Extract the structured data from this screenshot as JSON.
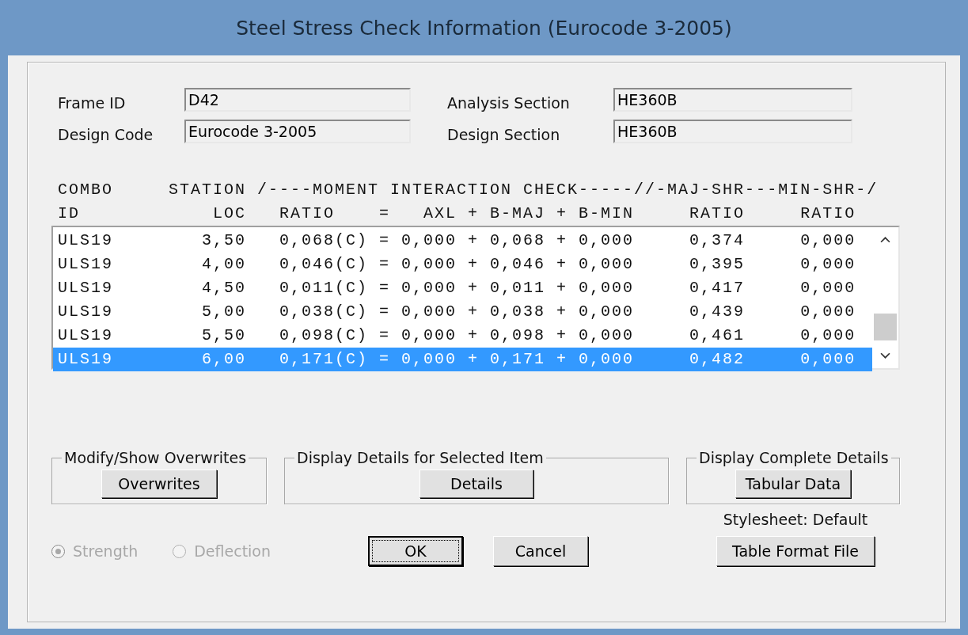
{
  "window": {
    "title": "Steel Stress Check Information (Eurocode 3-2005)"
  },
  "fields_left": [
    {
      "label": "Frame ID",
      "value": "D42"
    },
    {
      "label": "Design Code",
      "value": "Eurocode 3-2005"
    }
  ],
  "fields_right": [
    {
      "label": "Analysis Section",
      "value": "HE360B"
    },
    {
      "label": "Design Section",
      "value": "HE360B"
    }
  ],
  "table": {
    "header_lines": [
      "COMBO     STATION /----MOMENT INTERACTION CHECK-----//-MAJ-SHR---MIN-SHR-/",
      "ID            LOC   RATIO    =   AXL + B-MAJ + B-MIN     RATIO     RATIO"
    ],
    "rows": [
      {
        "text": "ULS19        3,50   0,068(C) = 0,000 + 0,068 + 0,000     0,374     0,000",
        "selected": false
      },
      {
        "text": "ULS19        4,00   0,046(C) = 0,000 + 0,046 + 0,000     0,395     0,000",
        "selected": false
      },
      {
        "text": "ULS19        4,50   0,011(C) = 0,000 + 0,011 + 0,000     0,417     0,000",
        "selected": false
      },
      {
        "text": "ULS19        5,00   0,038(C) = 0,000 + 0,038 + 0,000     0,439     0,000",
        "selected": false
      },
      {
        "text": "ULS19        5,50   0,098(C) = 0,000 + 0,098 + 0,000     0,461     0,000",
        "selected": false
      },
      {
        "text": "ULS19        6,00   0,171(C) = 0,000 + 0,171 + 0,000     0,482     0,000",
        "selected": true
      }
    ]
  },
  "groups": [
    {
      "title": "Modify/Show Overwrites",
      "button": "Overwrites"
    },
    {
      "title": "Display Details for Selected Item",
      "button": "Details"
    },
    {
      "title": "Display Complete Details",
      "button": "Tabular Data"
    }
  ],
  "stylesheet": "Stylesheet: Default",
  "radios": [
    {
      "label": "Strength",
      "selected": true,
      "disabled": true
    },
    {
      "label": "Deflection",
      "selected": false,
      "disabled": true
    }
  ],
  "buttons": [
    {
      "label": "OK",
      "focused": true
    },
    {
      "label": "Cancel",
      "focused": false
    }
  ],
  "table_format_button": "Table Format File"
}
